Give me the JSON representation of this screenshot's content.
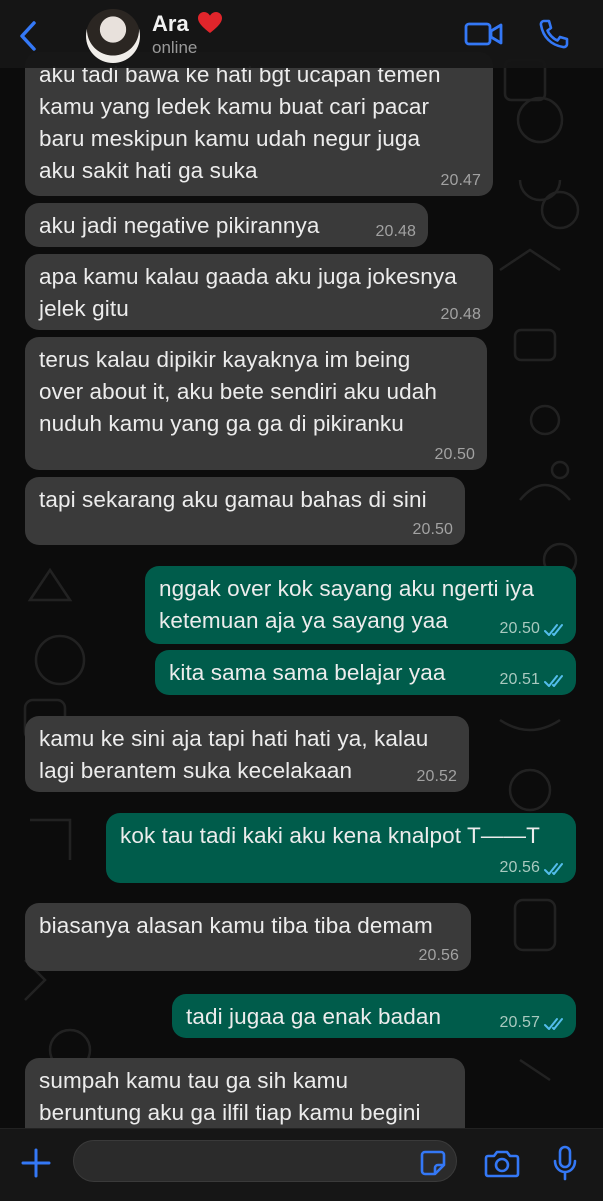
{
  "contact": {
    "name": "Ara",
    "status": "online"
  },
  "messages": [
    {
      "dir": "in",
      "text": "aku tadi bawa ke hati bgt ucapan temen\nkamu yang ledek kamu buat cari pacar\nbaru meskipun kamu udah negur juga\naku sakit hati ga suka",
      "time": "20.47"
    },
    {
      "dir": "in",
      "text": "aku jadi negative pikirannya",
      "time": "20.48"
    },
    {
      "dir": "in",
      "text": "apa kamu kalau gaada aku juga jokesnya\njelek gitu",
      "time": "20.48"
    },
    {
      "dir": "in",
      "text": "terus kalau dipikir kayaknya im being\nover about it, aku bete sendiri aku udah\nnuduh kamu yang ga ga di pikiranku",
      "time": "20.50"
    },
    {
      "dir": "in",
      "text": "tapi sekarang aku gamau bahas di sini",
      "time": "20.50"
    },
    {
      "dir": "out",
      "text": "nggak over kok sayang aku ngerti iya\nketemuan aja ya sayang yaa",
      "time": "20.50"
    },
    {
      "dir": "out",
      "text": "kita sama sama belajar yaa",
      "time": "20.51"
    },
    {
      "dir": "in",
      "text": "kamu ke sini aja tapi hati hati ya, kalau\nlagi berantem suka kecelakaan",
      "time": "20.52"
    },
    {
      "dir": "out",
      "text": "kok tau tadi kaki aku kena knalpot T——T",
      "time": "20.56"
    },
    {
      "dir": "in",
      "text": "biasanya alasan kamu tiba tiba demam",
      "time": "20.56"
    },
    {
      "dir": "out",
      "text": "tadi jugaa ga enak badan",
      "time": "20.57"
    },
    {
      "dir": "in",
      "text": "sumpah kamu tau ga sih kamu\nberuntung aku ga ilfil tiap kamu begini",
      "time": ""
    }
  ],
  "composer": {
    "value": "",
    "placeholder": ""
  },
  "colors": {
    "incoming_bubble": "#3a3a3a",
    "outgoing_bubble": "#005c4b",
    "accent": "#3478f6",
    "read_ticks": "#53bdeb"
  },
  "icons": {
    "back": "chevron-left-icon",
    "video": "video-camera-icon",
    "call": "phone-icon",
    "attach": "plus-icon",
    "sticker": "sticker-icon",
    "camera": "camera-icon",
    "mic": "microphone-icon"
  }
}
